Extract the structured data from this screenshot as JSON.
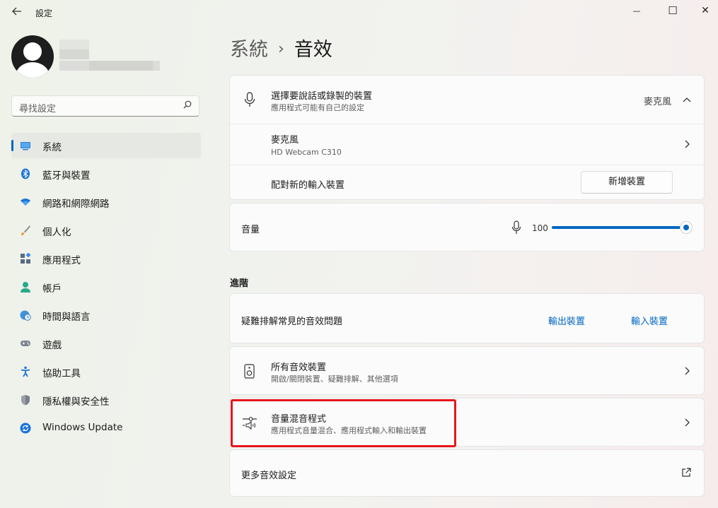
{
  "window": {
    "title": "設定",
    "minimize_glyph": "—",
    "maximize_glyph": "☐",
    "close_glyph": "✕"
  },
  "search": {
    "placeholder": "尋找設定",
    "icon": "search-icon"
  },
  "sidebar": {
    "items": [
      {
        "label": "系統",
        "icon": "monitor-icon",
        "active": true
      },
      {
        "label": "藍牙與裝置",
        "icon": "bluetooth-icon"
      },
      {
        "label": "網路和網際網路",
        "icon": "wifi-icon"
      },
      {
        "label": "個人化",
        "icon": "brush-icon"
      },
      {
        "label": "應用程式",
        "icon": "apps-icon"
      },
      {
        "label": "帳戶",
        "icon": "person-icon"
      },
      {
        "label": "時間與語言",
        "icon": "globe-clock-icon"
      },
      {
        "label": "遊戲",
        "icon": "gamepad-icon"
      },
      {
        "label": "協助工具",
        "icon": "accessibility-icon"
      },
      {
        "label": "隱私權與安全性",
        "icon": "shield-icon"
      },
      {
        "label": "Windows Update",
        "icon": "update-icon"
      }
    ]
  },
  "breadcrumb": {
    "parent": "系統",
    "separator": "›",
    "current": "音效"
  },
  "input_card": {
    "title": "選擇要說話或錄製的裝置",
    "subtitle": "應用程式可能有自己的設定",
    "selected": "麥克風",
    "device_name": "麥克風",
    "device_model": "HD Webcam C310",
    "pair_label": "配對新的輸入裝置",
    "add_button": "新增裝置"
  },
  "volume": {
    "label": "音量",
    "value": "100",
    "level_percent": 100,
    "accent": "#0067c0"
  },
  "advanced": {
    "section_title": "進階",
    "troubleshoot_label": "疑難排解常見的音效問題",
    "output_link": "輸出裝置",
    "input_link": "輸入裝置",
    "all_devices_title": "所有音效裝置",
    "all_devices_sub": "開啟/關閉裝置、疑難排解、其他選項",
    "mixer_title": "音量混音程式",
    "mixer_sub": "應用程式音量混合、應用程式輸入和輸出裝置",
    "more_settings": "更多音效設定"
  },
  "highlight_color": "#e8141c"
}
